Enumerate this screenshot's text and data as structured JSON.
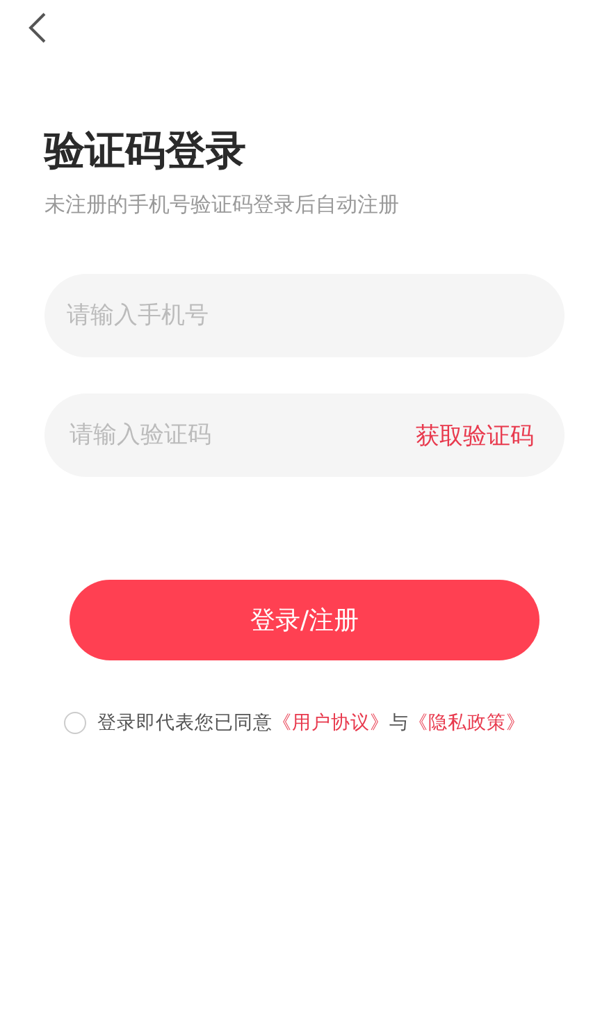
{
  "title": "验证码登录",
  "subtitle": "未注册的手机号验证码登录后自动注册",
  "phone_field": {
    "placeholder": "请输入手机号"
  },
  "code_field": {
    "placeholder": "请输入验证码",
    "action": "获取验证码"
  },
  "submit_button": "登录/注册",
  "agreement": {
    "checked": false,
    "text": "登录即代表您已同意",
    "link_1": "《用户协议》",
    "joiner": "与",
    "link_2": "《隐私政策》"
  }
}
